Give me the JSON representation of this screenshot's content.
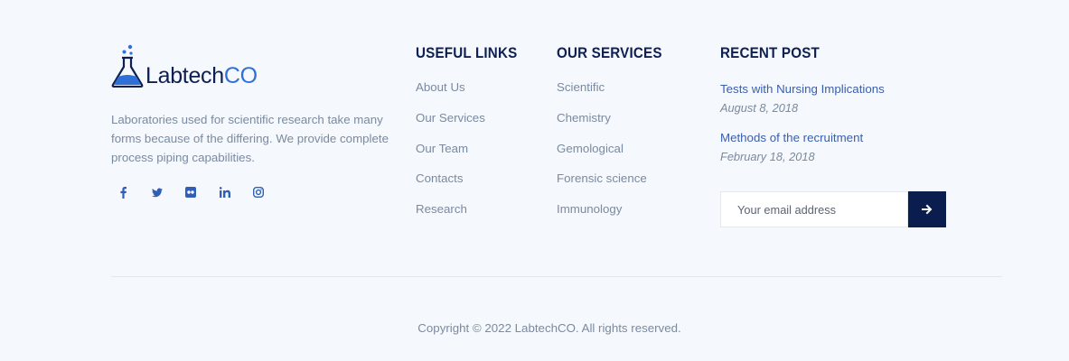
{
  "brand": {
    "name_main": "Labtech",
    "name_accent": "CO",
    "description": "Laboratories used for scientific research take many forms because of the differing. We provide complete process piping capabilities.",
    "social": [
      "facebook-icon",
      "twitter-icon",
      "flickr-icon",
      "linkedin-icon",
      "instagram-icon"
    ],
    "colors": {
      "dark": "#0e1f52",
      "accent": "#2f6fd8"
    }
  },
  "useful_links": {
    "title": "USEFUL LINKS",
    "items": [
      "About Us",
      "Our Services",
      "Our Team",
      "Contacts",
      "Research"
    ]
  },
  "services": {
    "title": "OUR SERVICES",
    "items": [
      "Scientific",
      "Chemistry",
      "Gemological",
      "Forensic science",
      "Immunology"
    ]
  },
  "recent_post": {
    "title": "RECENT POST",
    "posts": [
      {
        "title": "Tests with Nursing Implications",
        "date": "August 8, 2018"
      },
      {
        "title": "Methods of the recruitment",
        "date": "February 18, 2018"
      }
    ]
  },
  "subscribe": {
    "placeholder": "Your email address",
    "button_icon": "arrow-right-icon",
    "button_color": "#0b1d4f"
  },
  "copyright": "Copyright © 2022 LabtechCO. All rights reserved."
}
